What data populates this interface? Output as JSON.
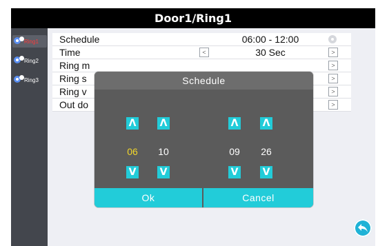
{
  "title": "Door1/Ring1",
  "sidebar": {
    "items": [
      {
        "label": "Ring1",
        "active": true
      },
      {
        "label": "Ring2",
        "active": false
      },
      {
        "label": "Ring3",
        "active": false
      }
    ]
  },
  "settings": {
    "schedule": {
      "label": "Schedule",
      "value": "06:00 - 12:00"
    },
    "time": {
      "label": "Time",
      "value": "30 Sec",
      "left_arrow": "<",
      "right_arrow": ">"
    },
    "ring_mode": {
      "label": "Ring m",
      "right_arrow": ">"
    },
    "ring_sound": {
      "label": "Ring s",
      "right_arrow": ">"
    },
    "ring_volume": {
      "label": "Ring v",
      "right_arrow": ">"
    },
    "out_door": {
      "label": "Out do",
      "right_arrow": ">"
    }
  },
  "dialog": {
    "title": "Schedule",
    "up_symbol": "Λ",
    "down_symbol": "V",
    "start_hour": "06",
    "start_minute": "10",
    "end_hour": "09",
    "end_minute": "26",
    "ok_label": "Ok",
    "cancel_label": "Cancel"
  },
  "colors": {
    "accent": "#22ccd9",
    "selected_digit": "#f1d62b",
    "active_sidebar_text": "#ff3b3b",
    "sidebar_bg": "#43464d",
    "dialog_bg": "#5b5b5b"
  },
  "icons": {
    "sidebar": "bell-add-icon",
    "settings": "gear-icon",
    "back": "back-arrow-icon"
  }
}
